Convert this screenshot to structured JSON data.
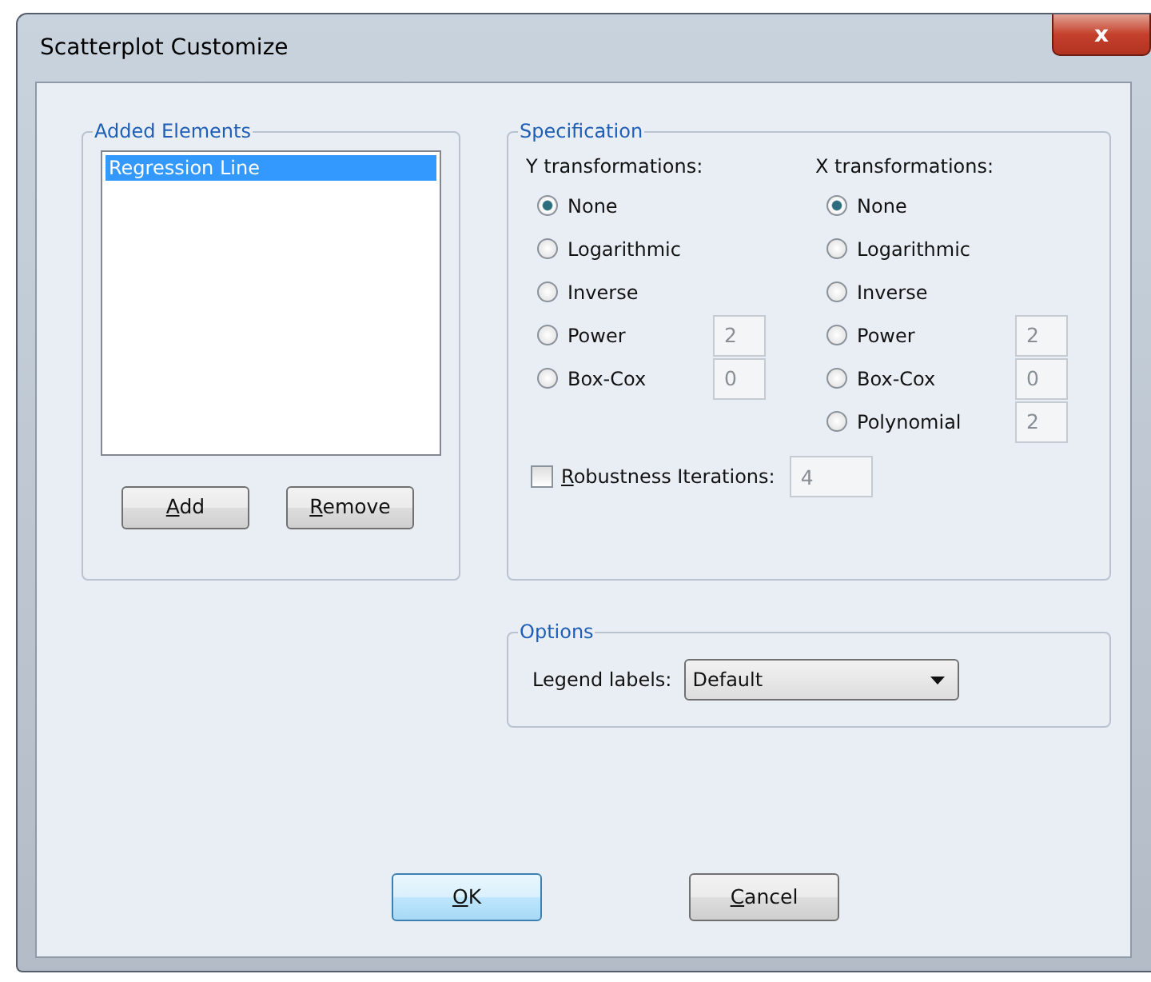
{
  "window": {
    "title": "Scatterplot Customize",
    "close": "x"
  },
  "added_elements": {
    "title": "Added Elements",
    "items": [
      {
        "label": "Regression Line",
        "selected": true
      }
    ],
    "buttons": [
      {
        "label": "Add",
        "mnemonic": true
      },
      {
        "label": "Remove",
        "mnemonic": true
      }
    ]
  },
  "specification": {
    "title": "Specification",
    "y_transformations": {
      "label": "Y transformations:",
      "options": [
        {
          "label": "None",
          "selected": true
        },
        {
          "label": "Logarithmic",
          "selected": false
        },
        {
          "label": "Inverse",
          "selected": false
        },
        {
          "label": "Power",
          "selected": false,
          "value": "2"
        },
        {
          "label": "Box-Cox",
          "selected": false,
          "value": "0"
        }
      ]
    },
    "x_transformations": {
      "label": "X transformations:",
      "options": [
        {
          "label": "None",
          "selected": true
        },
        {
          "label": "Logarithmic",
          "selected": false
        },
        {
          "label": "Inverse",
          "selected": false
        },
        {
          "label": "Power",
          "selected": false,
          "value": "2"
        },
        {
          "label": "Box-Cox",
          "selected": false,
          "value": "0"
        },
        {
          "label": "Polynomial",
          "selected": false,
          "value": "2"
        }
      ]
    },
    "robustness": {
      "label": "Robustness Iterations:",
      "mnemonic": true,
      "checked": false,
      "value": "4"
    }
  },
  "options": {
    "title": "Options",
    "legend_labels": {
      "label": "Legend labels:",
      "value": "Default"
    }
  },
  "buttons": [
    {
      "label": "OK",
      "mnemonic": true,
      "default": true
    },
    {
      "label": "Cancel",
      "mnemonic": true,
      "default": false
    }
  ]
}
